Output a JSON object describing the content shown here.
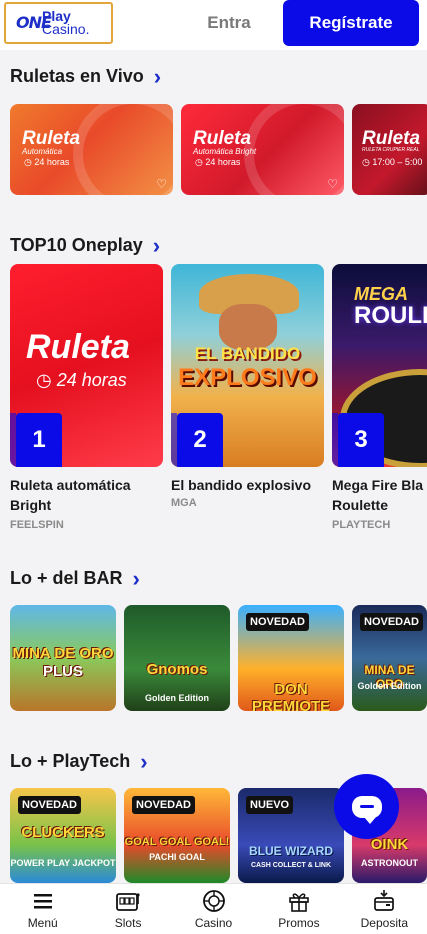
{
  "header": {
    "logo_one": "ONE",
    "logo_play": "Play",
    "logo_casino": "Casino.",
    "login_label": "Entra",
    "register_label": "Regístrate"
  },
  "sections": {
    "ruletas": {
      "title": "Ruletas en Vivo",
      "arrow": "›"
    },
    "top10": {
      "title": "TOP10 Oneplay",
      "arrow": "›"
    },
    "bar": {
      "title": "Lo + del BAR",
      "arrow": "›"
    },
    "playtech": {
      "title": "Lo + PlayTech",
      "arrow": "›"
    }
  },
  "ruletas_cards": [
    {
      "title": "Ruleta",
      "subtitle": "Automática",
      "hours": "◷ 24 horas"
    },
    {
      "title": "Ruleta",
      "subtitle": "Automática Bright",
      "hours": "◷ 24 horas"
    },
    {
      "title": "Ruleta",
      "subtitle": "RULETA CRUPIER REAL",
      "hours": "◷ 17:00 – 5:00"
    }
  ],
  "top10": [
    {
      "rank": "1",
      "art_title": "Ruleta",
      "art_sub": "◷ 24 horas",
      "name_line1": "Ruleta automática",
      "name_line2": "Bright",
      "provider": "FEELSPIN"
    },
    {
      "rank": "2",
      "art_title": "EL BANDIDO",
      "art_sub": "EXPLOSIVO",
      "name_line1": "El bandido explosivo",
      "name_line2": "",
      "provider": "MGA"
    },
    {
      "rank": "3",
      "art_title": "MEGA",
      "art_sub": "ROULE",
      "name_line1": "Mega Fire Bla",
      "name_line2": "Roulette",
      "provider": "PLAYTECH"
    }
  ],
  "bar_games": [
    {
      "badge": "",
      "title": "MINA DE ORO",
      "sub": "PLUS"
    },
    {
      "badge": "",
      "title": "Gnomos",
      "sub": "Golden Edition"
    },
    {
      "badge": "NOVEDAD",
      "title": "DON PREMIOTE",
      "sub": ""
    },
    {
      "badge": "NOVEDAD",
      "title": "MINA DE ORO",
      "sub": "Golden Edition"
    }
  ],
  "playtech_games": [
    {
      "badge": "NOVEDAD",
      "title": "CLUCKERS",
      "sub": "POWER PLAY JACKPOT"
    },
    {
      "badge": "NOVEDAD",
      "title": "GOAL GOAL GOAL!",
      "sub": "PACHI GOAL"
    },
    {
      "badge": "NUEVO",
      "title": "BLUE WIZARD",
      "sub": "CASH COLLECT & LINK"
    },
    {
      "badge": "NO",
      "title": "OINK",
      "sub": "ASTRONOUT"
    }
  ],
  "bottom_nav": [
    {
      "label": "Menú",
      "icon": "menu-icon"
    },
    {
      "label": "Slots",
      "icon": "slots-icon"
    },
    {
      "label": "Casino",
      "icon": "roulette-icon"
    },
    {
      "label": "Promos",
      "icon": "gift-icon"
    },
    {
      "label": "Deposita",
      "icon": "wallet-icon"
    }
  ],
  "colors": {
    "brand_blue": "#0b0be8",
    "logo_border": "#e3a43a"
  }
}
